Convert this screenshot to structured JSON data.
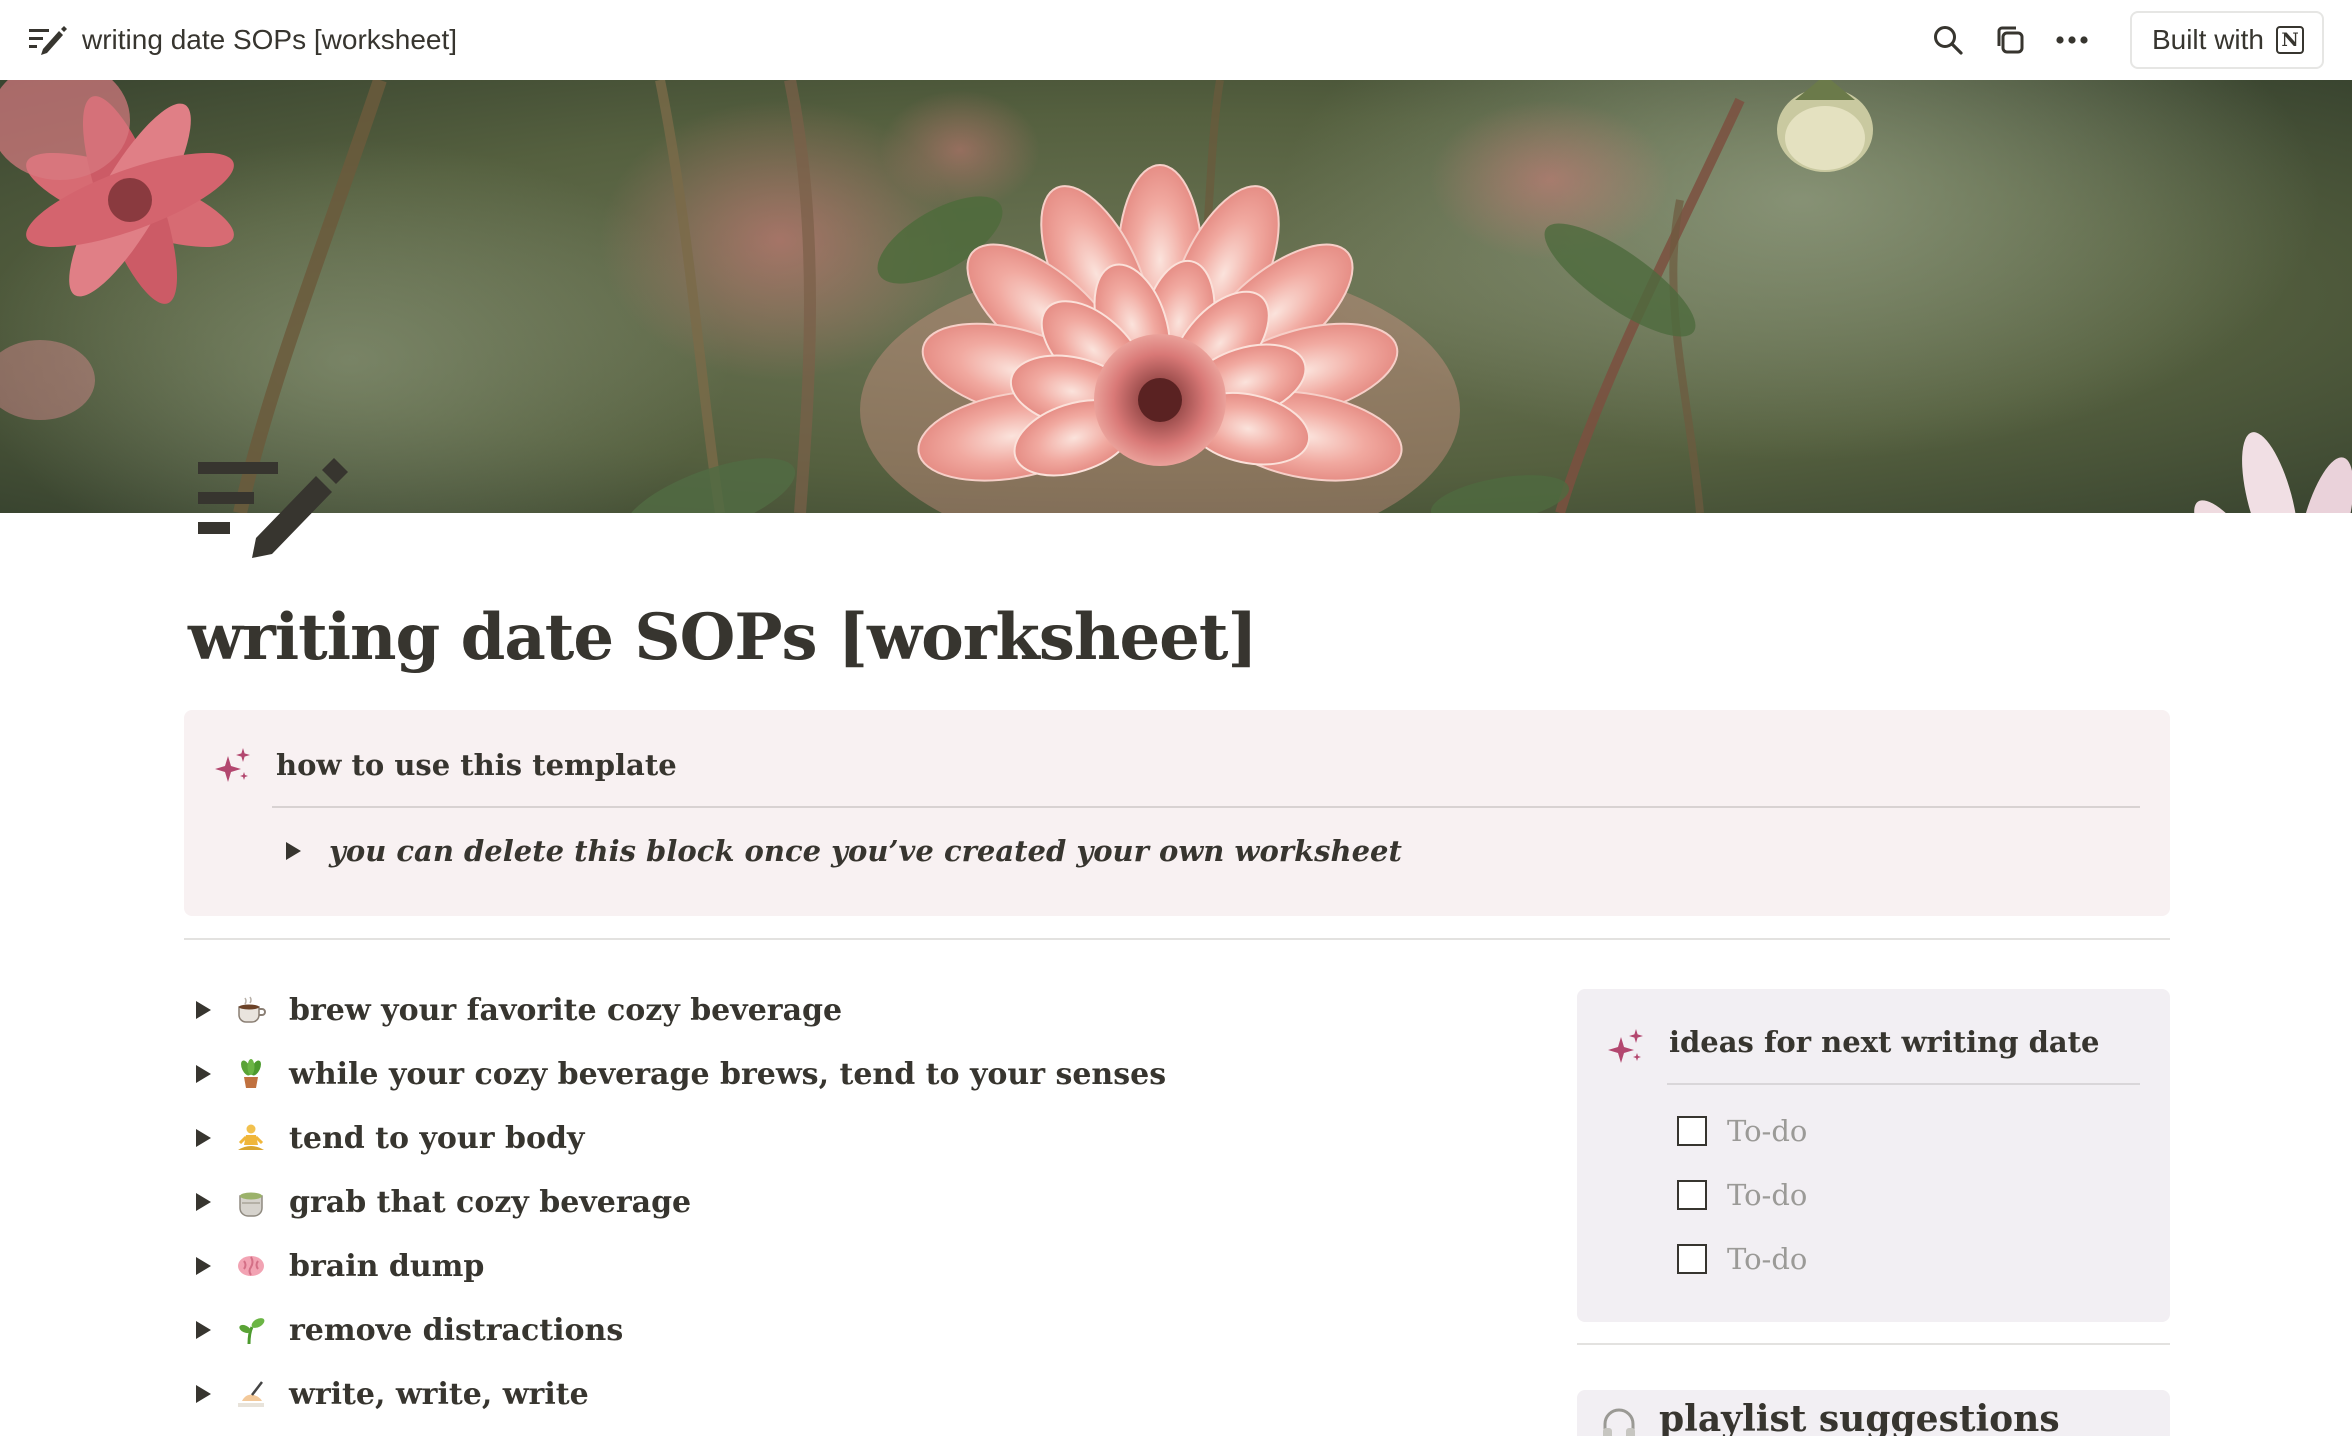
{
  "topbar": {
    "page_title": "writing date SOPs [worksheet]",
    "built_with_label": "Built with",
    "built_with_logo_letter": "N",
    "actions": [
      "search-icon",
      "duplicate-icon",
      "more-icon"
    ]
  },
  "page": {
    "title": "writing date SOPs [worksheet]",
    "icon": "writing-icon"
  },
  "callout": {
    "icon": "sparkle-icon",
    "heading": "how to use this template",
    "toggle_text": "you can delete this block once you’ve created your own worksheet"
  },
  "toggles": [
    {
      "emoji": "hot-beverage-icon",
      "label": "brew your favorite cozy beverage"
    },
    {
      "emoji": "potted-plant-icon",
      "label": "while your cozy beverage brews, tend to your senses"
    },
    {
      "emoji": "meditation-icon",
      "label": "tend to your body"
    },
    {
      "emoji": "tea-cup-icon",
      "label": "grab that cozy beverage"
    },
    {
      "emoji": "brain-icon",
      "label": "brain dump"
    },
    {
      "emoji": "seedling-icon",
      "label": "remove distractions"
    },
    {
      "emoji": "writing-hand-icon",
      "label": "write, write, write"
    }
  ],
  "ideas": {
    "icon": "sparkle-icon",
    "heading": "ideas for next writing date",
    "todos": [
      {
        "text": "To-do",
        "checked": false
      },
      {
        "text": "To-do",
        "checked": false
      },
      {
        "text": "To-do",
        "checked": false
      }
    ]
  },
  "playlist": {
    "icon": "headphones-icon",
    "heading": "playlist suggestions"
  },
  "colors": {
    "text": "#37352f",
    "callout_bg": "#f8f1f2",
    "ideas_bg": "#f2eff3",
    "sparkle": "#b3476f",
    "placeholder": "#9b9a97"
  }
}
